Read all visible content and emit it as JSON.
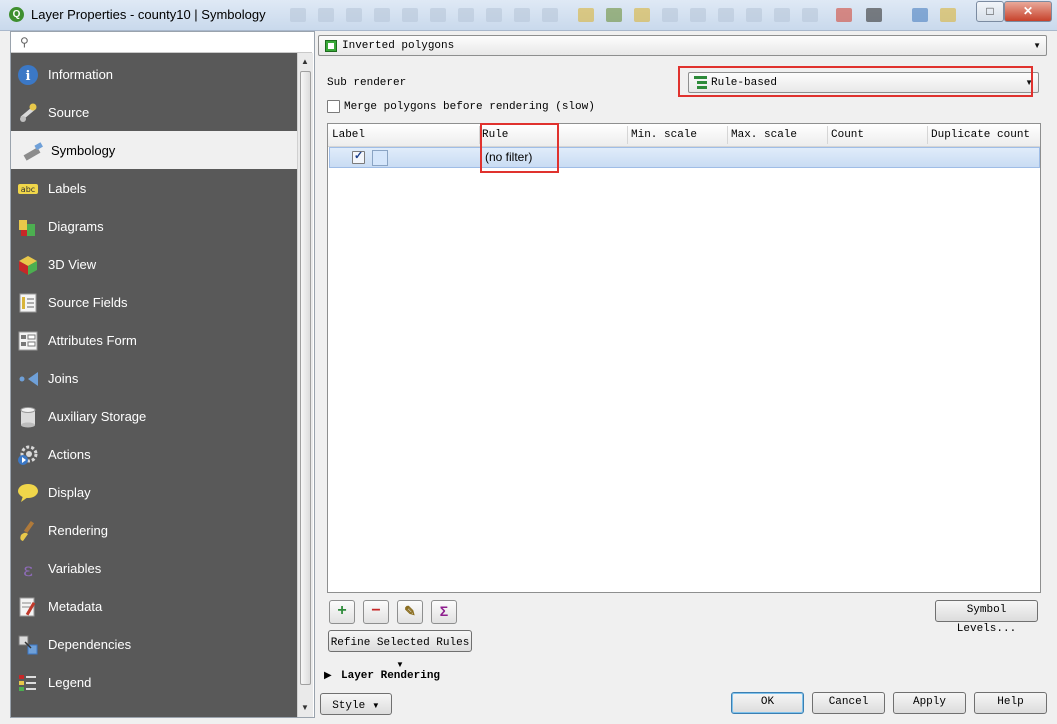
{
  "window": {
    "title": "Layer Properties - county10 | Symbology"
  },
  "sidebar": {
    "items": [
      {
        "label": "Information",
        "icon": "info-icon"
      },
      {
        "label": "Source",
        "icon": "wrench-icon"
      },
      {
        "label": "Symbology",
        "icon": "paintbrush-icon",
        "active": true
      },
      {
        "label": "Labels",
        "icon": "abc-label-icon"
      },
      {
        "label": "Diagrams",
        "icon": "diagram-icon"
      },
      {
        "label": "3D View",
        "icon": "cube-icon"
      },
      {
        "label": "Source Fields",
        "icon": "fields-icon"
      },
      {
        "label": "Attributes Form",
        "icon": "form-icon"
      },
      {
        "label": "Joins",
        "icon": "join-icon"
      },
      {
        "label": "Auxiliary Storage",
        "icon": "database-icon"
      },
      {
        "label": "Actions",
        "icon": "gear-icon"
      },
      {
        "label": "Display",
        "icon": "speech-bubble-icon"
      },
      {
        "label": "Rendering",
        "icon": "brush-icon"
      },
      {
        "label": "Variables",
        "icon": "epsilon-icon"
      },
      {
        "label": "Metadata",
        "icon": "document-pen-icon"
      },
      {
        "label": "Dependencies",
        "icon": "dependencies-icon"
      },
      {
        "label": "Legend",
        "icon": "legend-icon"
      }
    ]
  },
  "renderer": {
    "selected": "Inverted polygons"
  },
  "sub_renderer": {
    "label": "Sub renderer",
    "selected": "Rule-based"
  },
  "merge_polygons": {
    "label": "Merge polygons before rendering (slow)",
    "checked": false
  },
  "rules_table": {
    "columns": [
      "Label",
      "Rule",
      "Min. scale",
      "Max. scale",
      "Count",
      "Duplicate count"
    ],
    "rows": [
      {
        "label": "",
        "rule": "(no filter)",
        "checked": true
      }
    ]
  },
  "toolbar": {
    "add": "+",
    "remove": "−",
    "edit": "✎",
    "sum": "Σ",
    "symbol_levels": "Symbol Levels...",
    "refine": "Refine Selected Rules"
  },
  "layer_rendering": {
    "label": "Layer Rendering"
  },
  "footer": {
    "style": "Style",
    "ok": "OK",
    "cancel": "Cancel",
    "apply": "Apply",
    "help": "Help"
  },
  "colors": {
    "sidebar_bg": "#595959",
    "highlight": "#e0322e",
    "selection": "#c9dcf3"
  }
}
